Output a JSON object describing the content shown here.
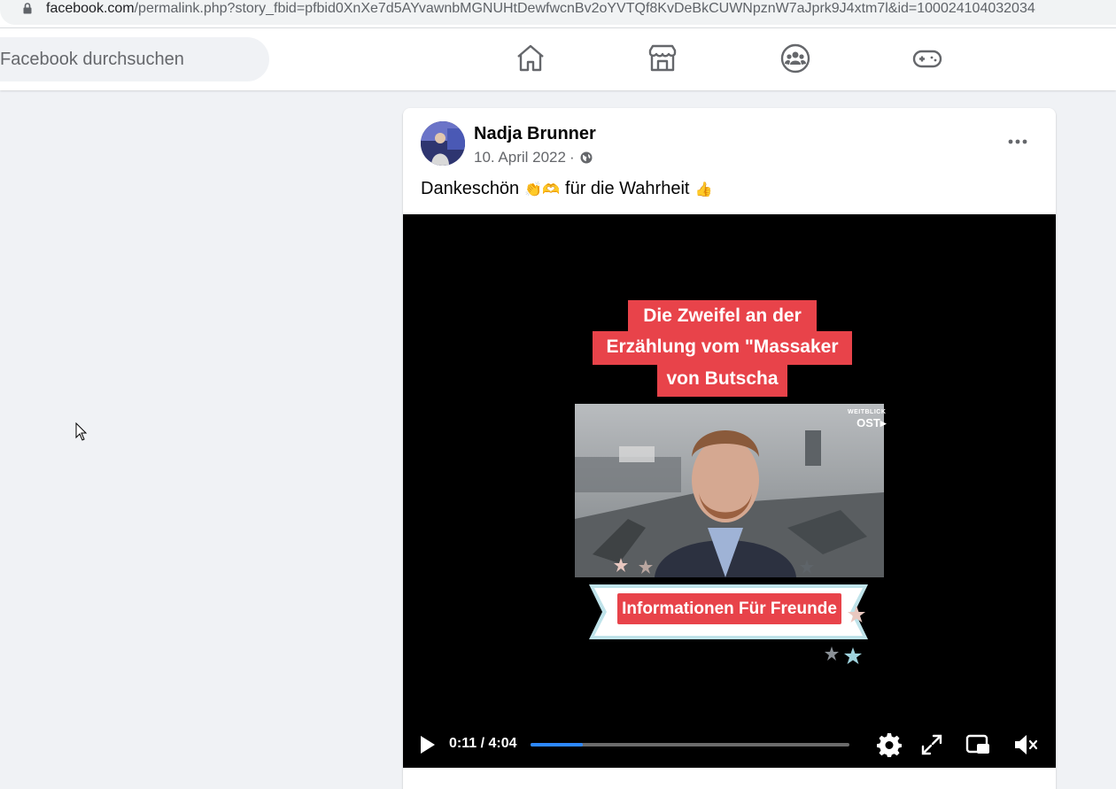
{
  "browser": {
    "url_host": "facebook.com",
    "url_path": "/permalink.php?story_fbid=pfbid0XnXe7d5AYvawnbMGNUHtDewfwcnBv2oYVTQf8KvDeBkCUWNpznW7aJprk9J4xtm7l&id=100024104032034"
  },
  "header": {
    "search_placeholder": "Facebook durchsuchen",
    "nav_icons": [
      "home-icon",
      "marketplace-icon",
      "groups-icon",
      "gaming-icon"
    ]
  },
  "post": {
    "author": "Nadja Brunner",
    "date": "10. April 2022",
    "separator": "·",
    "text_before": "Dankeschön",
    "emoji_1": "👏🫶",
    "text_after": "für die Wahrheit",
    "emoji_2": "👍"
  },
  "video": {
    "headline_line1": "Die Zweifel an der",
    "headline_line2": "Erzählung vom \"Massaker",
    "headline_line3": "von Butscha",
    "banner_label": "Informationen Für Freunde",
    "watermark_small": "WEITBLICK",
    "watermark_big": "OST",
    "time_display": "0:11 / 4:04",
    "progress_fraction": 0.165
  },
  "colors": {
    "accent": "#2d88ff",
    "banner_red": "#e8434a",
    "page_bg": "#f0f2f5"
  }
}
